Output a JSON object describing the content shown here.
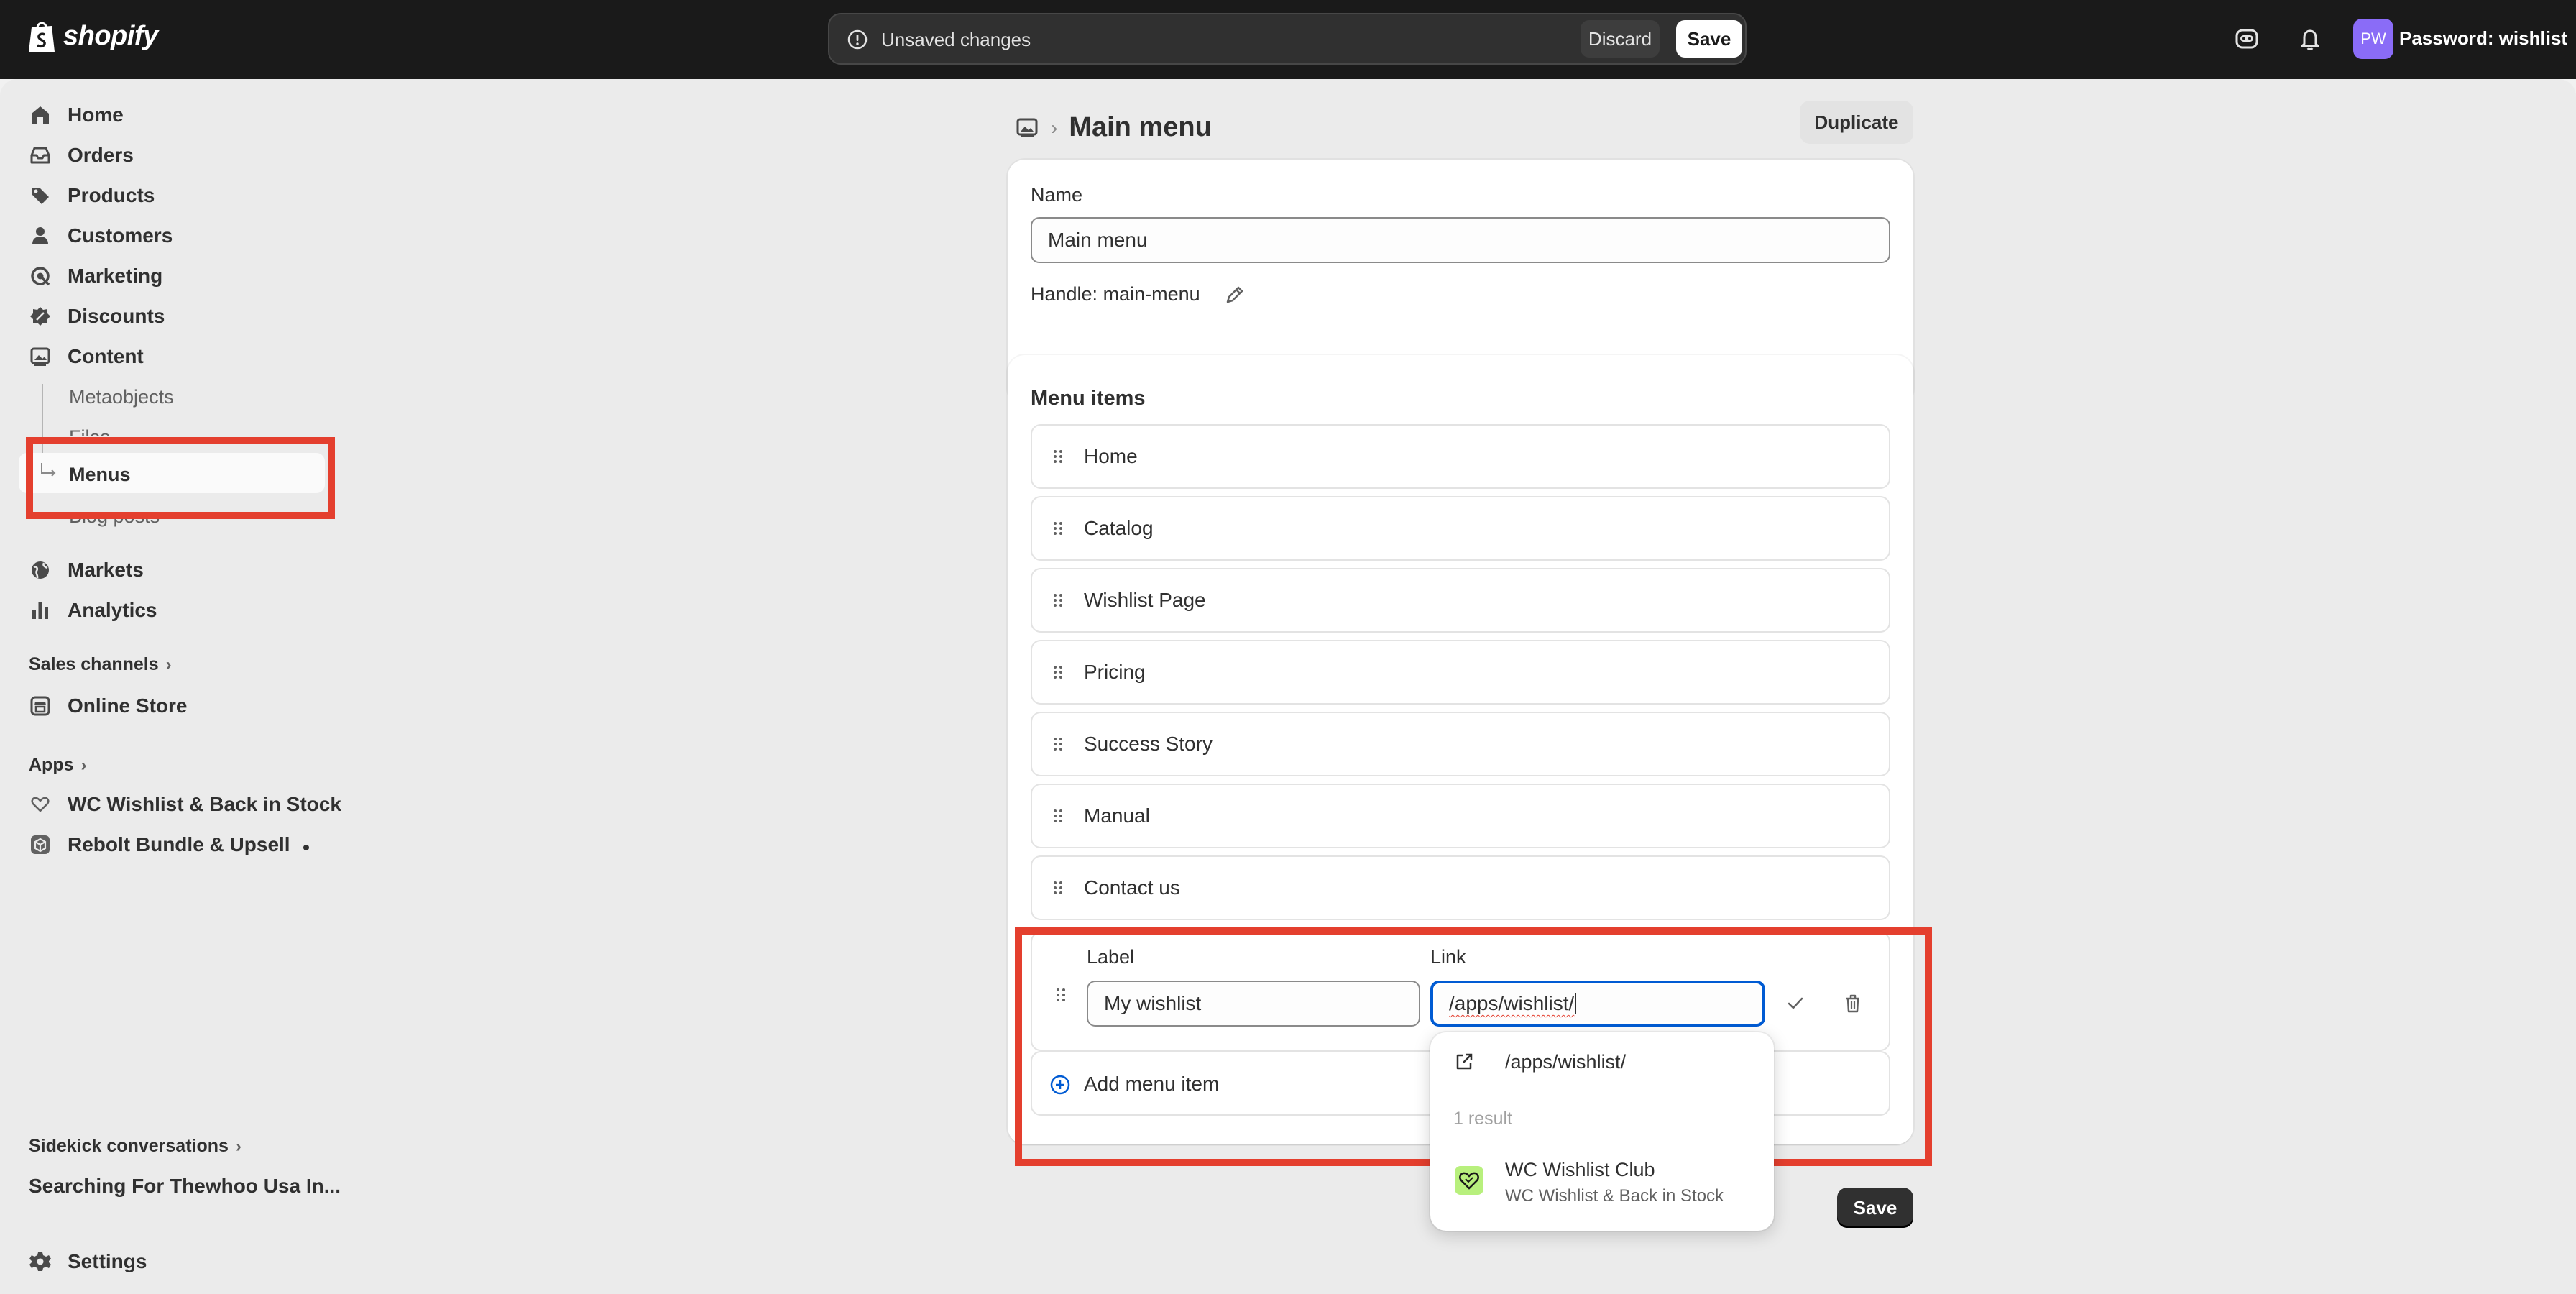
{
  "topbar": {
    "brand": "shopify",
    "unsaved_message": "Unsaved changes",
    "discard_label": "Discard",
    "save_label": "Save",
    "avatar_initials": "PW",
    "store_name": "Password: wishlist"
  },
  "sidebar": {
    "nav": [
      {
        "label": "Home",
        "icon": "home-icon"
      },
      {
        "label": "Orders",
        "icon": "inbox-icon"
      },
      {
        "label": "Products",
        "icon": "tag-icon"
      },
      {
        "label": "Customers",
        "icon": "person-icon"
      },
      {
        "label": "Marketing",
        "icon": "target-icon"
      },
      {
        "label": "Discounts",
        "icon": "discount-icon"
      },
      {
        "label": "Content",
        "icon": "image-icon"
      }
    ],
    "content_sub": [
      "Metaobjects",
      "Files",
      "Menus",
      "Blog posts"
    ],
    "nav2": [
      {
        "label": "Markets",
        "icon": "globe-icon"
      },
      {
        "label": "Analytics",
        "icon": "bar-chart-icon"
      }
    ],
    "sales_channels_label": "Sales channels",
    "online_store_label": "Online Store",
    "apps_label": "Apps",
    "apps": [
      {
        "label": "WC Wishlist & Back in Stock",
        "icon": "heart-icon"
      },
      {
        "label": "Rebolt Bundle & Upsell",
        "icon": "box-icon"
      }
    ],
    "sidekick_label": "Sidekick conversations",
    "sidekick_item": "Searching For Thewhoo Usa In...",
    "settings_label": "Settings"
  },
  "page": {
    "title": "Main menu",
    "duplicate_label": "Duplicate",
    "name_label": "Name",
    "name_value": "Main menu",
    "handle_text": "Handle: main-menu",
    "menu_items_heading": "Menu items",
    "menu_items": [
      "Home",
      "Catalog",
      "Wishlist Page",
      "Pricing",
      "Success Story",
      "Manual",
      "Contact us"
    ],
    "edit": {
      "label_heading": "Label",
      "link_heading": "Link",
      "label_value": "My wishlist",
      "link_value": "/apps/wishlist/"
    },
    "add_menu_item": "Add menu item",
    "save_label": "Save"
  },
  "dropdown": {
    "link_option": "/apps/wishlist/",
    "result_count": "1 result",
    "result_title": "WC Wishlist Club",
    "result_subtitle": "WC Wishlist & Back in Stock"
  },
  "colors": {
    "topbar_bg": "#1a1a1a",
    "highlight": "#e43f2e",
    "focus": "#005bd3",
    "avatar": "#8a6cf7"
  }
}
